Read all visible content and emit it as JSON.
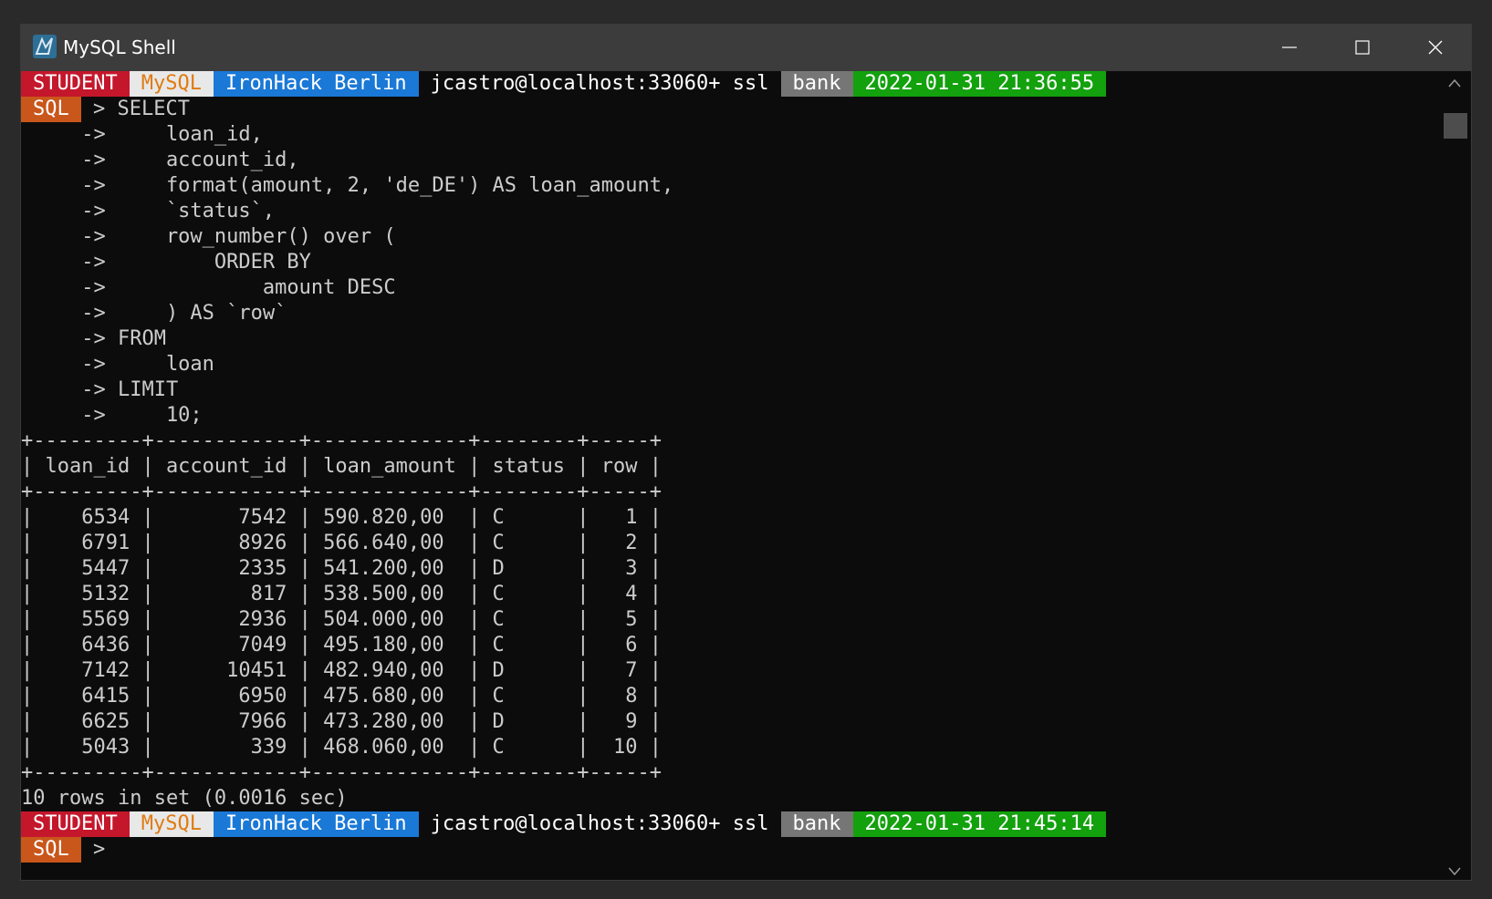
{
  "window": {
    "title": "MySQL Shell"
  },
  "prompt": {
    "segments": [
      {
        "name": "role",
        "text": "STUDENT",
        "bg": "#c4172c",
        "fg": "#ffffff"
      },
      {
        "name": "mysql",
        "text": "MySQL",
        "bg": "#e8e8e8",
        "fg": "#e07b12"
      },
      {
        "name": "institution",
        "text": "IronHack Berlin",
        "bg": "#1a78d6",
        "fg": "#ffffff"
      },
      {
        "name": "connection",
        "text": "jcastro@localhost:33060+ ssl",
        "bg": "#0c0c0c",
        "fg": "#ffffff"
      },
      {
        "name": "schema",
        "text": "bank",
        "bg": "#767676",
        "fg": "#ffffff"
      }
    ],
    "timestamp_1": "2022-01-31 21:36:55",
    "timestamp_2": "2022-01-31 21:45:14",
    "timestamp_bg": "#13a10e",
    "mode": "SQL",
    "mode_bg": "#c9561b"
  },
  "query": {
    "first_line": " > SELECT",
    "continuation_lines": [
      "     ->     loan_id,",
      "     ->     account_id,",
      "     ->     format(amount, 2, 'de_DE') AS loan_amount,",
      "     ->     `status`,",
      "     ->     row_number() over (",
      "     ->         ORDER BY",
      "     ->             amount DESC",
      "     ->     ) AS `row`",
      "     -> FROM",
      "     ->     loan",
      "     -> LIMIT",
      "     ->     10;"
    ]
  },
  "result": {
    "columns": [
      "loan_id",
      "account_id",
      "loan_amount",
      "status",
      "row"
    ],
    "rows": [
      [
        "6534",
        "7542",
        "590.820,00",
        "C",
        "1"
      ],
      [
        "6791",
        "8926",
        "566.640,00",
        "C",
        "2"
      ],
      [
        "5447",
        "2335",
        "541.200,00",
        "D",
        "3"
      ],
      [
        "5132",
        "817",
        "538.500,00",
        "C",
        "4"
      ],
      [
        "5569",
        "2936",
        "504.000,00",
        "C",
        "5"
      ],
      [
        "6436",
        "7049",
        "495.180,00",
        "C",
        "6"
      ],
      [
        "7142",
        "10451",
        "482.940,00",
        "D",
        "7"
      ],
      [
        "6415",
        "6950",
        "475.680,00",
        "C",
        "8"
      ],
      [
        "6625",
        "7966",
        "473.280,00",
        "D",
        "9"
      ],
      [
        "5043",
        "339",
        "468.060,00",
        "C",
        "10"
      ]
    ],
    "summary": "10 rows in set (0.0016 sec)"
  },
  "final_prompt": " >"
}
